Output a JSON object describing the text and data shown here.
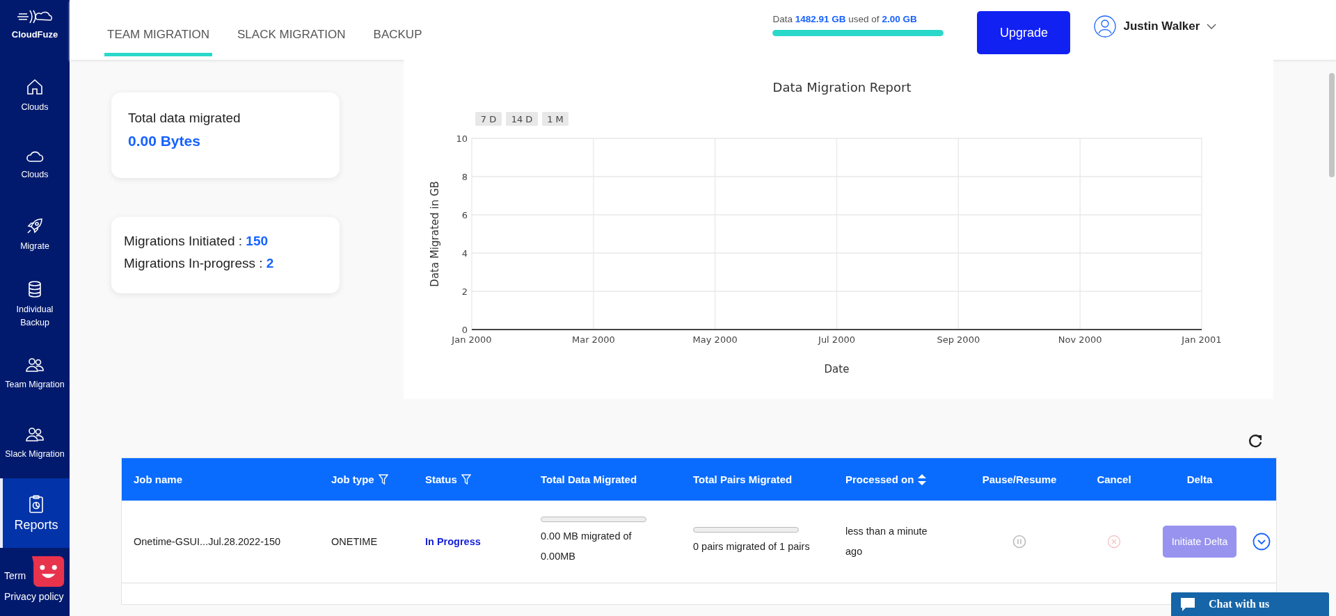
{
  "sidebar": {
    "logo": "CloudFuze",
    "items": [
      {
        "label": "Clouds",
        "kind": "home",
        "selected": false
      },
      {
        "label": "Clouds",
        "kind": "cloud",
        "selected": false
      },
      {
        "label": "Migrate",
        "kind": "rocket",
        "selected": false
      },
      {
        "label": "Individual Backup",
        "kind": "database",
        "selected": false
      },
      {
        "label": "Team Migration",
        "kind": "users",
        "selected": false
      },
      {
        "label": "Slack Migration",
        "kind": "users",
        "selected": false
      },
      {
        "label": "Reports",
        "kind": "clipboard",
        "selected": true
      }
    ],
    "footer_links": [
      "Term",
      "Privacy policy"
    ]
  },
  "tabs": [
    {
      "label": "TEAM MIGRATION",
      "selected": true
    },
    {
      "label": "SLACK MIGRATION",
      "selected": false
    },
    {
      "label": "BACKUP",
      "selected": false
    }
  ],
  "usage": {
    "text": "Data **1482.91 GB** used of **2.00 GB**",
    "level": 1
  },
  "upgrade_button": "Upgrade",
  "user": {
    "name": "Justin Walker"
  },
  "total_card": {
    "label": "Total data migrated",
    "value": "0.00 Bytes"
  },
  "stats_card": [
    {
      "label": "Migrations Initiated : ",
      "value": "150"
    },
    {
      "label": "Migrations In-progress : ",
      "value": "2"
    }
  ],
  "chart": {
    "range_buttons": [
      "7 D",
      "14 D",
      "1 M"
    ],
    "chart_data": {
      "type": "line",
      "title": "Data Migration Report",
      "xlabel": "Date",
      "ylabel": "Data Migrated in GB",
      "ylim": [
        0,
        10
      ],
      "grid": true,
      "categories": [
        "Jan 2000",
        "Mar 2000",
        "May 2000",
        "Jul 2000",
        "Sep 2000",
        "Nov 2000",
        "Jan 2001"
      ],
      "yticks": [
        0,
        2,
        4,
        6,
        8,
        10
      ]
    }
  },
  "table": {
    "columns": [
      {
        "label": "Job name",
        "kind": "plain"
      },
      {
        "label": "Job type",
        "kind": "filter"
      },
      {
        "label": "Status",
        "kind": "filter"
      },
      {
        "label": "Total Data Migrated",
        "kind": "plain"
      },
      {
        "label": "Total Pairs Migrated",
        "kind": "plain"
      },
      {
        "label": "Processed on",
        "kind": "sort"
      },
      {
        "label": "Pause/Resume",
        "kind": "center"
      },
      {
        "label": "Cancel",
        "kind": "center"
      },
      {
        "label": "Delta",
        "kind": "center"
      }
    ],
    "rows": [
      {
        "job_name": "Onetime-GSUI...Jul.28.2022-150",
        "job_type": "ONETIME",
        "status": "In Progress",
        "data_progress": {
          "level": 0,
          "text": "0.00 MB migrated of 0.00MB"
        },
        "pairs_progress": {
          "level": 0,
          "text": "0 pairs migrated of 1 pairs"
        },
        "processed_on": "less than a minute ago",
        "pause_disabled": true,
        "cancel_disabled": true,
        "delta_button": "Initiate Delta",
        "delta_disabled": true
      }
    ]
  },
  "chat_button": "Chat with us"
}
